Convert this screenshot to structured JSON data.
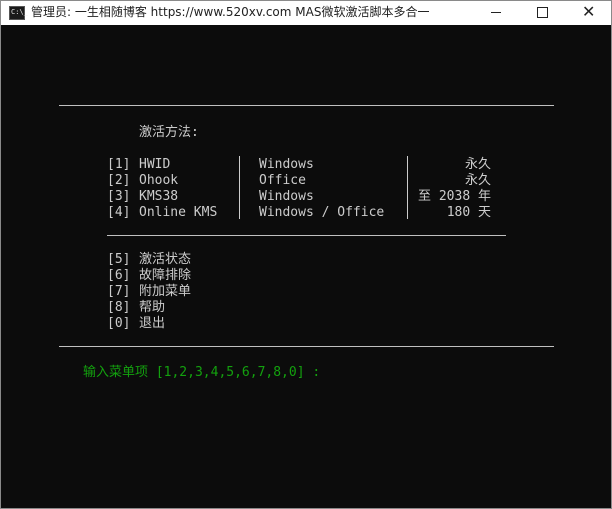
{
  "window": {
    "title": "管理员:   一生相随博客 https://www.520xv.com   MAS微软激活脚本多合一",
    "icon": "console-icon",
    "icon_glyph": "C:\\_",
    "controls": {
      "minimize": "minimize-icon",
      "maximize": "maximize-icon",
      "close": "close-icon",
      "close_glyph": "✕"
    }
  },
  "console": {
    "text_color": "#cccccc",
    "prompt_color": "#13a10e",
    "background": "#0c0c0c",
    "heading": "激活方法:",
    "methods": [
      {
        "num": "[1]",
        "name": "HWID",
        "product": "Windows",
        "duration": "永久"
      },
      {
        "num": "[2]",
        "name": "Ohook",
        "product": "Office",
        "duration": "永久"
      },
      {
        "num": "[3]",
        "name": "KMS38",
        "product": "Windows",
        "duration": "至 2038 年"
      },
      {
        "num": "[4]",
        "name": "Online KMS",
        "product": "Windows / Office",
        "duration": "180 天"
      }
    ],
    "options": [
      {
        "num": "[5]",
        "label": "激活状态"
      },
      {
        "num": "[6]",
        "label": "故障排除"
      },
      {
        "num": "[7]",
        "label": "附加菜单"
      },
      {
        "num": "[8]",
        "label": "帮助"
      },
      {
        "num": "[0]",
        "label": "退出"
      }
    ],
    "prompt": "输入菜单项 [1,2,3,4,5,6,7,8,0] :"
  }
}
